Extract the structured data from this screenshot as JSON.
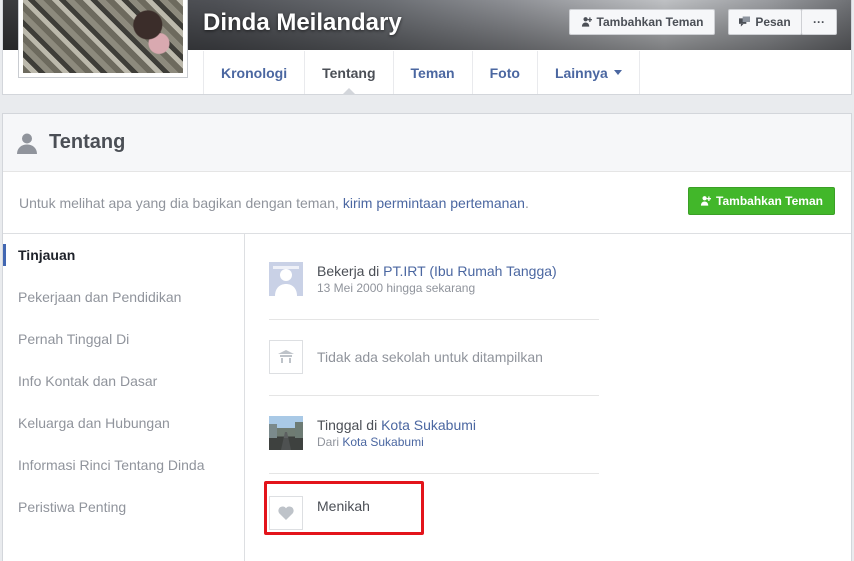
{
  "header": {
    "name": "Dinda Meilandary",
    "add_friend_label": "Tambahkan Teman",
    "message_label": "Pesan",
    "more_label": "···",
    "tabs": [
      {
        "label": "Kronologi"
      },
      {
        "label": "Tentang"
      },
      {
        "label": "Teman"
      },
      {
        "label": "Foto"
      },
      {
        "label": "Lainnya"
      }
    ]
  },
  "about": {
    "title": "Tentang",
    "notice_text": "Untuk melihat apa yang dia bagikan dengan teman,",
    "notice_link": "kirim permintaan pertemanan",
    "notice_end": ".",
    "add_friend_label": "Tambahkan Teman",
    "nav": [
      {
        "label": "Tinjauan"
      },
      {
        "label": "Pekerjaan dan Pendidikan"
      },
      {
        "label": "Pernah Tinggal Di"
      },
      {
        "label": "Info Kontak dan Dasar"
      },
      {
        "label": "Keluarga dan Hubungan"
      },
      {
        "label": "Informasi Rinci Tentang Dinda"
      },
      {
        "label": "Peristiwa Penting"
      }
    ],
    "work": {
      "prefix": "Bekerja di",
      "company": "PT.IRT (Ibu Rumah Tangga)",
      "period": "13 Mei 2000 hingga sekarang"
    },
    "school": {
      "text": "Tidak ada sekolah untuk ditampilkan"
    },
    "home": {
      "prefix": "Tinggal di",
      "city": "Kota Sukabumi",
      "from_prefix": "Dari",
      "from_city": "Kota Sukabumi"
    },
    "relationship": {
      "text": "Menikah"
    }
  },
  "colors": {
    "link": "#4b67a1",
    "green_button": "#42b72a",
    "active_nav_bar": "#4267b2",
    "highlight_box": "#e3141b"
  },
  "icons": {
    "add_friend": "person-plus-icon",
    "message": "chat-icon",
    "more": "ellipsis-icon",
    "section": "person-silhouette-icon",
    "school": "school-icon",
    "relationship": "heart-icon"
  }
}
